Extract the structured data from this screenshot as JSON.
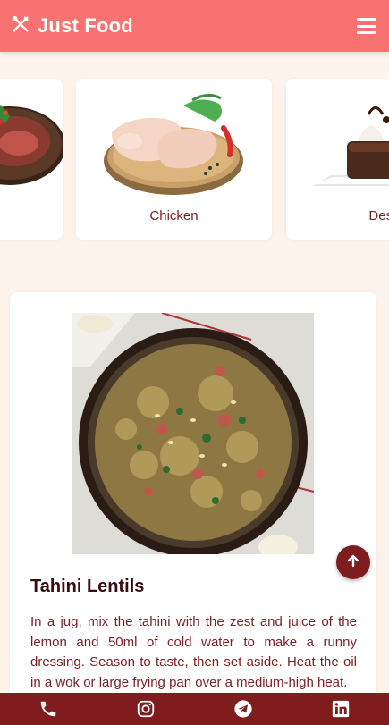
{
  "header": {
    "brand_title": "Just Food",
    "brand_icon": "utensils-icon",
    "menu_icon": "hamburger-menu-icon"
  },
  "categories": [
    {
      "label": "",
      "image": "steak-image"
    },
    {
      "label": "Chicken",
      "image": "chicken-image"
    },
    {
      "label": "Dess",
      "image": "dessert-image"
    }
  ],
  "recipe": {
    "title": "Tahini Lentils",
    "image": "lentils-dish-image",
    "description": "In a jug, mix the tahini with the zest and juice of the lemon and 50ml of cold water to make a runny dressing. Season to taste, then set aside. Heat the oil in a wok or large frying pan over a medium-high heat."
  },
  "footer": {
    "icons": [
      "phone-icon",
      "instagram-icon",
      "telegram-icon",
      "linkedin-icon"
    ]
  },
  "colors": {
    "header_bg": "#f87272",
    "page_bg": "#fdf3eb",
    "footer_bg": "#7e1c1e",
    "text_maroon": "#7a1f24",
    "title_dark": "#3a0a0c"
  }
}
